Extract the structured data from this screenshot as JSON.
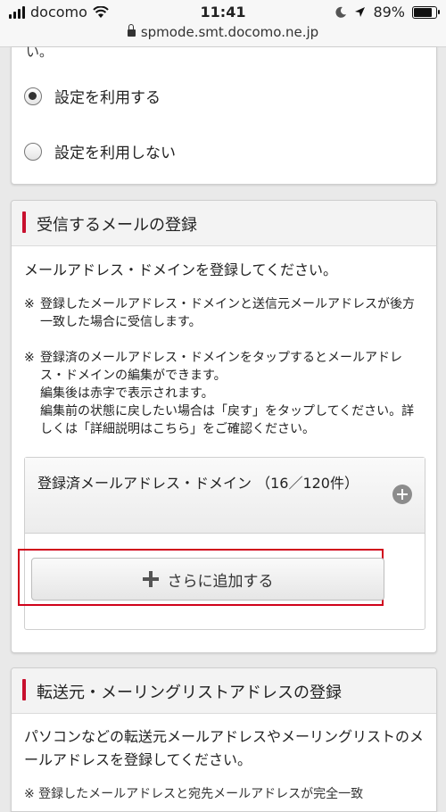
{
  "status_bar": {
    "carrier": "docomo",
    "time": "11:41",
    "battery": "89%",
    "battery_level": 0.89,
    "url": "spmode.smt.docomo.ne.jp"
  },
  "top_section": {
    "partial_text": "い。",
    "options": [
      {
        "label": "設定を利用する",
        "checked": true
      },
      {
        "label": "設定を利用しない",
        "checked": false
      }
    ]
  },
  "receive_section": {
    "title": "受信するメールの登録",
    "lead": "メールアドレス・ドメインを登録してください。",
    "notes": [
      {
        "mark": "※",
        "text": "登録したメールアドレス・ドメインと送信元メールアドレスが後方一致した場合に受信します。"
      },
      {
        "mark": "※",
        "text": "登録済のメールアドレス・ドメインをタップするとメールアドレス・ドメインの編集ができます。\n編集後は赤字で表示されます。\n編集前の状態に戻したい場合は「戻す」をタップしてください。詳しくは「詳細説明はこちら」をご確認ください。"
      }
    ],
    "registered_label": "登録済メールアドレス・ドメイン （16／120件）",
    "add_button": "さらに追加する"
  },
  "forward_section": {
    "title": "転送元・メーリングリストアドレスの登録",
    "lead": "パソコンなどの転送元メールアドレスやメーリングリストのメールアドレスを登録してください。",
    "partial_note": "※ 登録したメールアドレスと宛先メールアドレスが完全一致"
  },
  "colors": {
    "accent": "#c8102e",
    "highlight": "#d0021b"
  }
}
